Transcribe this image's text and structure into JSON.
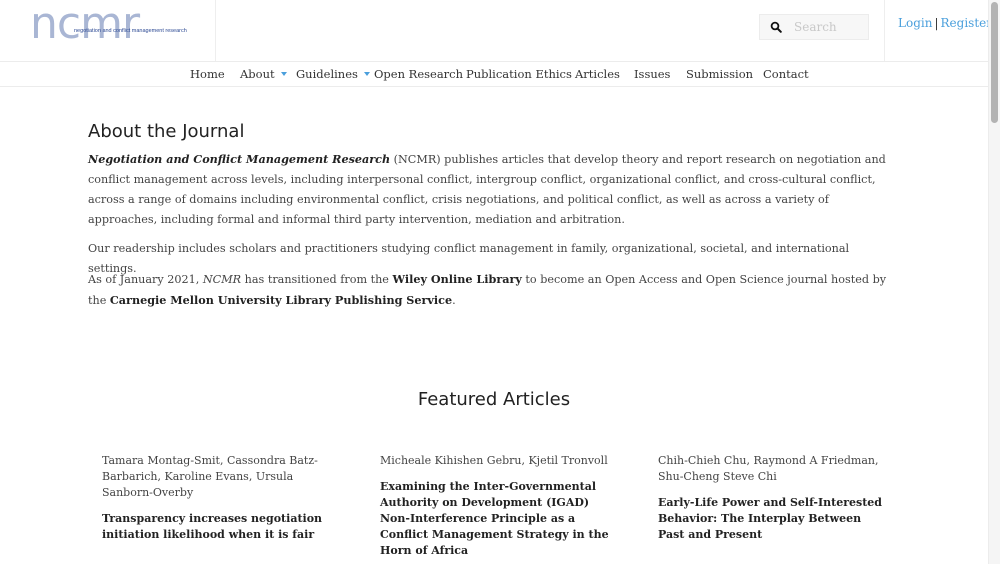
{
  "header": {
    "logo": {
      "wordmark": "ncmr",
      "tagline": "negotiation and conflict management research"
    },
    "search": {
      "placeholder": "Search",
      "value": "",
      "icon": "search-icon"
    },
    "auth": {
      "login_label": "Login",
      "separator": "|",
      "register_label": "Register"
    }
  },
  "nav": {
    "items": [
      {
        "label": "Home",
        "has_dropdown": false
      },
      {
        "label": "About",
        "has_dropdown": true
      },
      {
        "label": "Guidelines",
        "has_dropdown": true
      },
      {
        "label": "Open Research",
        "has_dropdown": false
      },
      {
        "label": "Publication Ethics",
        "has_dropdown": false
      },
      {
        "label": "Articles",
        "has_dropdown": false
      },
      {
        "label": "Issues",
        "has_dropdown": false
      },
      {
        "label": "Submission",
        "has_dropdown": false
      },
      {
        "label": "Contact",
        "has_dropdown": false
      }
    ],
    "accent_color": "#4a9fdc"
  },
  "about": {
    "title": "About the Journal",
    "p1": {
      "journal_name": "Negotiation and Conflict Management Research",
      "text": " (NCMR) publishes articles that develop theory and report research on negotiation and conflict management across levels, including interpersonal conflict, intergroup conflict, organizational conflict, and cross-cultural conflict, across a range of domains including environmental conflict, crisis negotiations, and political conflict, as well as across a variety of approaches, including formal and informal third party intervention, mediation and arbitration."
    },
    "p2": "Our readership includes scholars and practitioners studying conflict management in family, organizational, societal, and international settings.",
    "p3": {
      "t1": "As of January 2021, ",
      "abbr": "NCMR",
      "t2": " has transitioned from the ",
      "wiley": "Wiley Online Library",
      "t3": " to become an Open Access and Open Science journal hosted by the ",
      "cmu": "Carnegie Mellon University Library Publishing Service",
      "t4": "."
    }
  },
  "featured": {
    "title": "Featured Articles",
    "articles": [
      {
        "authors": "Tamara Montag-Smit, Cassondra Batz-Barbarich, Karoline Evans, Ursula Sanborn-Overby",
        "title": "Transparency increases negotiation initiation likelihood when it is fair"
      },
      {
        "authors": "Micheale Kihishen Gebru, Kjetil Tronvoll",
        "title": "Examining the Inter-Governmental Authority on Development (IGAD) Non-Interference Principle as a Conflict Management Strategy in the Horn of Africa"
      },
      {
        "authors": "Chih-Chieh Chu, Raymond A Friedman, Shu-Cheng Steve Chi",
        "title": "Early-Life Power and Self-Interested Behavior: The Interplay Between Past and Present"
      }
    ]
  }
}
